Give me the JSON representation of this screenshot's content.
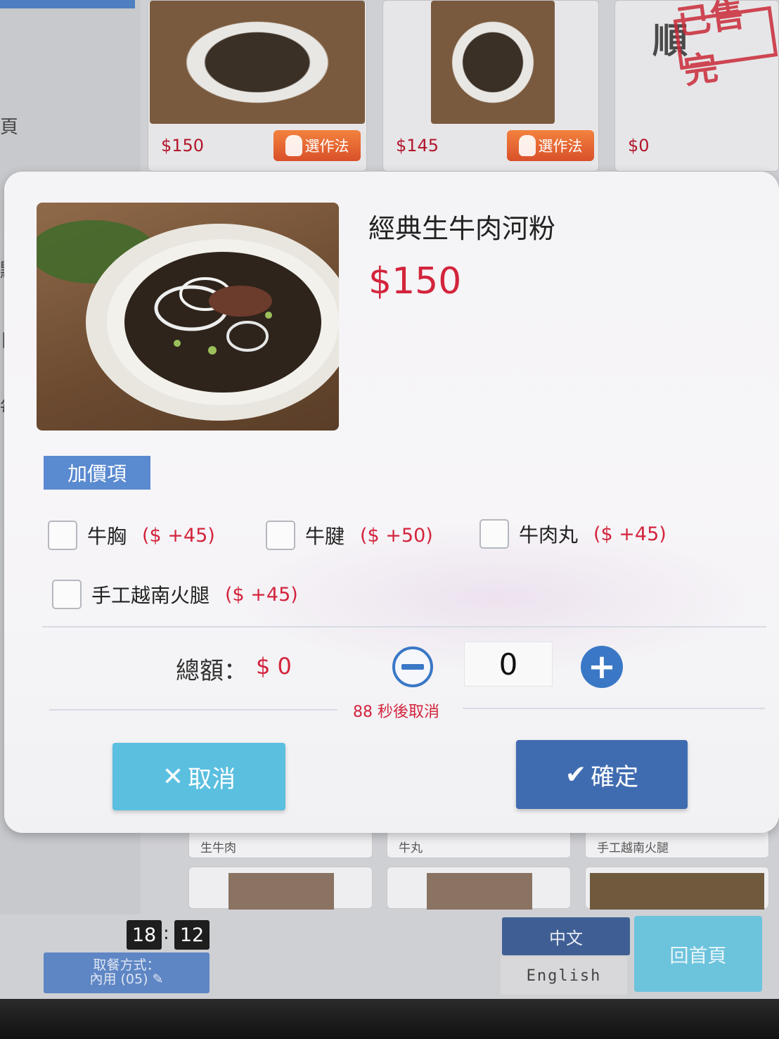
{
  "background": {
    "menu_cards": [
      {
        "price": "$150",
        "select_label": "選作法"
      },
      {
        "price": "$145",
        "select_label": "選作法"
      },
      {
        "price": "$0"
      }
    ],
    "sold_out_stamp": "已售完",
    "sold_out_prefix": "順",
    "left_side_chars": [
      "頁",
      "點",
      "日",
      "每日"
    ],
    "sub_items": [
      "生牛肉",
      "牛丸",
      "手工越南火腿"
    ]
  },
  "modal": {
    "title": "經典生牛肉河粉",
    "price": "$150",
    "section_label": "加價項",
    "options": [
      {
        "name": "牛胸",
        "price": "($ +45)",
        "checked": false
      },
      {
        "name": "牛腱",
        "price": "($ +50)",
        "checked": false
      },
      {
        "name": "牛肉丸",
        "price": "($ +45)",
        "checked": false
      },
      {
        "name": "手工越南火腿",
        "price": "($ +45)",
        "checked": false
      }
    ],
    "total_label": "總額：",
    "total_value": "$ 0",
    "quantity": "0",
    "countdown": "88 秒後取消",
    "cancel_label": "取消",
    "confirm_label": "確定"
  },
  "footer": {
    "clock_hour": "18",
    "clock_minute": "12",
    "order_mode_line1": "取餐方式：",
    "order_mode_line2": "內用 (05)",
    "lang_zh": "中文",
    "lang_en": "English",
    "home_label": "回首頁"
  },
  "colors": {
    "accent_red": "#d3243c",
    "primary_blue": "#3f6cb0",
    "cancel_cyan": "#5bbfe0",
    "tag_blue": "#5a8ad0"
  }
}
